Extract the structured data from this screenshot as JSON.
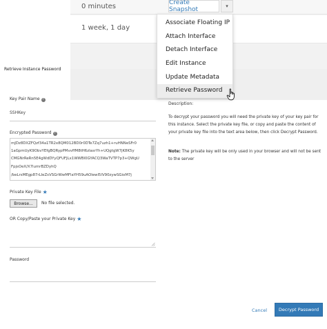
{
  "background_table": {
    "rows": [
      {
        "uptime": "0 minutes"
      },
      {
        "uptime": "1 week, 1 day"
      }
    ],
    "create_snapshot_label": "Create Snapshot",
    "caret_glyph": "▾"
  },
  "actions_menu": {
    "items": [
      {
        "label": "Associate Floating IP",
        "active": false
      },
      {
        "label": "Attach Interface",
        "active": false
      },
      {
        "label": "Detach Interface",
        "active": false
      },
      {
        "label": "Edit Instance",
        "active": false
      },
      {
        "label": "Update Metadata",
        "active": false
      },
      {
        "label": "Retrieve Password",
        "active": true
      }
    ]
  },
  "modal": {
    "title": "Retrieve Instance Password",
    "key_pair": {
      "label": "Key Pair Name",
      "value": "SSHKey"
    },
    "encrypted_password": {
      "label": "Encrypted Password",
      "lines": [
        "mJDz8DXZFQzf34a1TR2x8QM012BD0r0DTe7Zq7uzh1+ruHNNeSFr0",
        "1aGpmUyK9ObvYEfgBQRypPMvvffM8tH6zlasrYh+UQgtgW7jK8K5y",
        "CMGNrReRn5E4gWdDYyQFUFJLx1WWBl0GYACQ3WaTVTP7p3+QWgU",
        "FpjsOeX/X7lumrBZDyhQ",
        "/beLrsMEgp87rLIeZsVSGrWwMFlaYH59uAOlewI5lV90zywSGioM7j"
      ]
    },
    "private_key_file": {
      "label": "Private Key File",
      "browse_label": "Browse...",
      "status": "No file selected."
    },
    "paste_key": {
      "label": "OR Copy/Paste your Private Key"
    },
    "password": {
      "label": "Password"
    },
    "description": {
      "title": "Description:",
      "text": "To decrypt your password you will need the private key of your key pair for this instance. Select the private key file, or copy and paste the content of your private key file into the text area below, then click Decrypt Password.",
      "note_label": "Note:",
      "note_text": " The private key will be only used in your browser and will not be sent to the server"
    },
    "cancel_label": "Cancel",
    "decrypt_label": "Decrypt Password"
  },
  "colors": {
    "accent": "#337ab7",
    "border": "#cccccc",
    "menu_active": "#ececec"
  }
}
